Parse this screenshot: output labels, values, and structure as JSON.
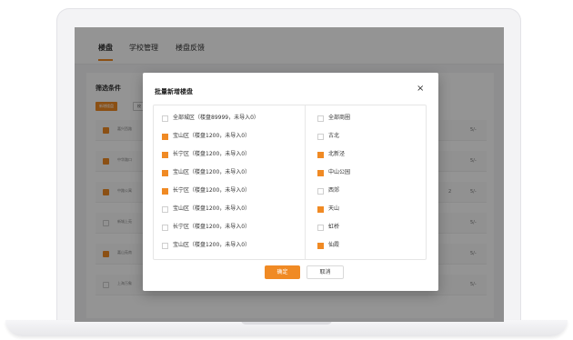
{
  "app": {
    "tabs": [
      {
        "label": "楼盘"
      },
      {
        "label": "学校管理"
      },
      {
        "label": "楼盘反馈"
      }
    ],
    "filter_title": "筛选条件",
    "filter_tags": [
      "新增楼盘",
      "校"
    ],
    "rows": [
      {
        "name": "嘉兴西路",
        "tail": "5/-"
      },
      {
        "name": "中华路口",
        "tail": "5/-"
      },
      {
        "name": "中路公寓",
        "tail": "5/-",
        "mid": "2"
      },
      {
        "name": "新城上苑",
        "tail": "5/-"
      },
      {
        "name": "嘉山苑南",
        "tail": "5/-"
      },
      {
        "name": "上海万象",
        "tail": "5/-"
      }
    ]
  },
  "modal": {
    "title": "批量新增楼盘",
    "close": "×",
    "left_options": [
      {
        "label": "全部城区（楼盘89999，未导入0）",
        "checked": false
      },
      {
        "label": "宝山区（楼盘1200，未导入0）",
        "checked": true
      },
      {
        "label": "长宁区（楼盘1200，未导入0）",
        "checked": true
      },
      {
        "label": "宝山区（楼盘1200，未导入0）",
        "checked": true
      },
      {
        "label": "长宁区（楼盘1200，未导入0）",
        "checked": true
      },
      {
        "label": "宝山区（楼盘1200，未导入0）",
        "checked": false
      },
      {
        "label": "长宁区（楼盘1200，未导入0）",
        "checked": false
      },
      {
        "label": "宝山区（楼盘1200，未导入0）",
        "checked": false
      }
    ],
    "right_options": [
      {
        "label": "全部商圈",
        "checked": false
      },
      {
        "label": "古北",
        "checked": false
      },
      {
        "label": "北新泾",
        "checked": true
      },
      {
        "label": "中山公园",
        "checked": true
      },
      {
        "label": "西郊",
        "checked": false
      },
      {
        "label": "天山",
        "checked": true
      },
      {
        "label": "虹桥",
        "checked": false
      },
      {
        "label": "仙霞",
        "checked": true
      }
    ],
    "confirm_label": "确定",
    "cancel_label": "取消"
  },
  "colors": {
    "accent": "#f08a24",
    "overlay": "rgba(0,0,0,0.42)"
  }
}
